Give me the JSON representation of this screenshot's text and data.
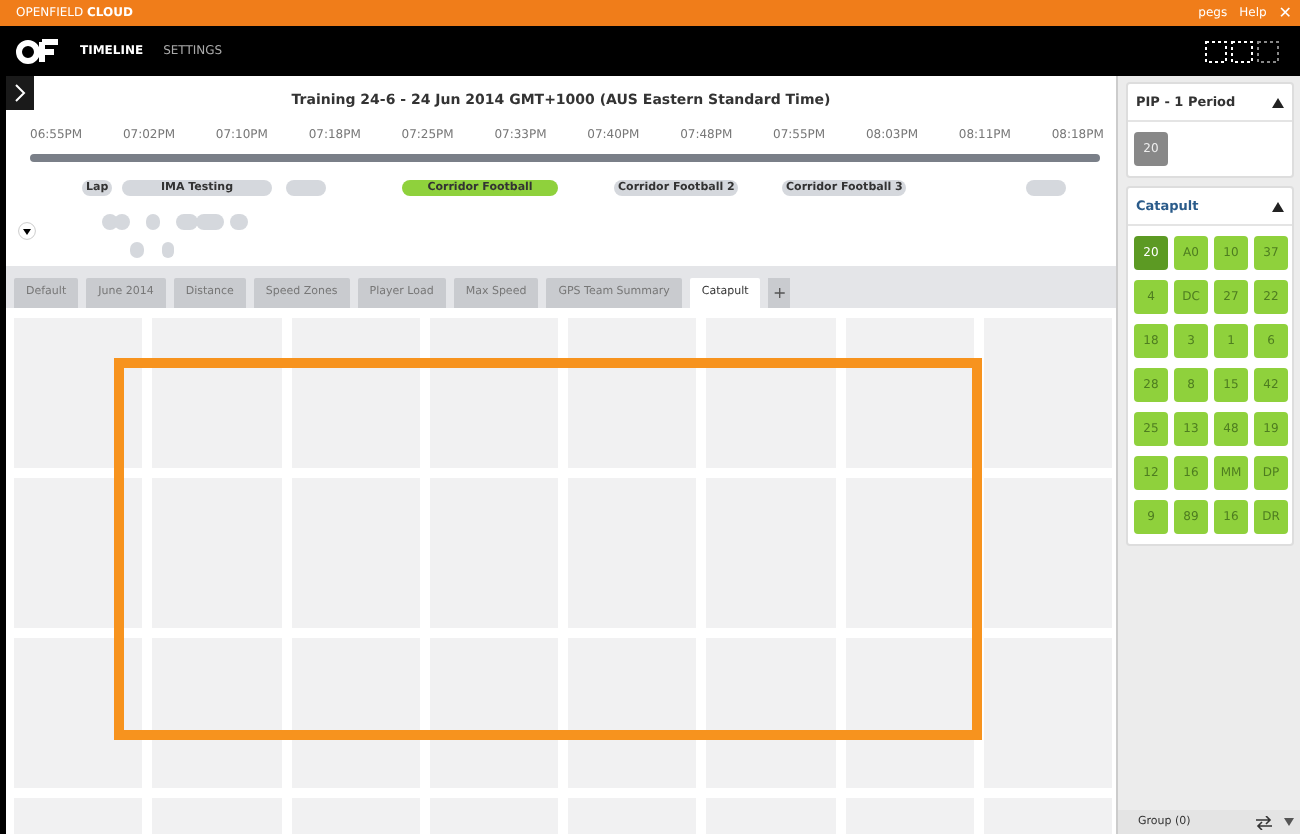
{
  "brand": {
    "light": "OPENFIELD",
    "bold": "CLOUD"
  },
  "user_links": [
    "pegs",
    "Help"
  ],
  "close_glyph": "✕",
  "nav": [
    {
      "label": "TIMELINE",
      "selected": true
    },
    {
      "label": "SETTINGS",
      "selected": false
    }
  ],
  "timeline": {
    "title": "Training 24-6 - 24 Jun 2014 GMT+1000 (AUS Eastern Standard Time)",
    "ticks": [
      "06:55PM",
      "07:02PM",
      "07:10PM",
      "07:18PM",
      "07:25PM",
      "07:33PM",
      "07:40PM",
      "07:48PM",
      "07:55PM",
      "08:03PM",
      "08:11PM",
      "08:18PM"
    ],
    "events": [
      {
        "label": "Lap",
        "selected": false
      },
      {
        "label": "IMA Testing",
        "selected": false
      },
      {
        "label": "Corridor Football",
        "selected": true
      },
      {
        "label": "Corridor Football 2",
        "selected": false
      },
      {
        "label": "Corridor Football 3",
        "selected": false
      }
    ]
  },
  "tabs": [
    {
      "label": "Default",
      "selected": false
    },
    {
      "label": "June 2014",
      "selected": false
    },
    {
      "label": "Distance",
      "selected": false
    },
    {
      "label": "Speed Zones",
      "selected": false
    },
    {
      "label": "Player Load",
      "selected": false
    },
    {
      "label": "Max Speed",
      "selected": false
    },
    {
      "label": "GPS Team Summary",
      "selected": false
    },
    {
      "label": "Catapult",
      "selected": true
    }
  ],
  "add_tab": "+",
  "panels": [
    {
      "title": "PIP - 1 Period",
      "kind": "grey",
      "tiles": [
        {
          "label": "20",
          "selected": false
        }
      ]
    },
    {
      "title": "Catapult",
      "kind": "green",
      "tiles": [
        {
          "label": "20",
          "selected": true
        },
        {
          "label": "A0",
          "selected": false
        },
        {
          "label": "10",
          "selected": false
        },
        {
          "label": "37",
          "selected": false
        },
        {
          "label": "4",
          "selected": false
        },
        {
          "label": "DC",
          "selected": false
        },
        {
          "label": "27",
          "selected": false
        },
        {
          "label": "22",
          "selected": false
        },
        {
          "label": "18",
          "selected": false
        },
        {
          "label": "3",
          "selected": false
        },
        {
          "label": "1",
          "selected": false
        },
        {
          "label": "6",
          "selected": false
        },
        {
          "label": "28",
          "selected": false
        },
        {
          "label": "8",
          "selected": false
        },
        {
          "label": "15",
          "selected": false
        },
        {
          "label": "42",
          "selected": false
        },
        {
          "label": "25",
          "selected": false
        },
        {
          "label": "13",
          "selected": false
        },
        {
          "label": "48",
          "selected": false
        },
        {
          "label": "19",
          "selected": false
        },
        {
          "label": "12",
          "selected": false
        },
        {
          "label": "16",
          "selected": false
        },
        {
          "label": "MM",
          "selected": false
        },
        {
          "label": "DP",
          "selected": false
        },
        {
          "label": "9",
          "selected": false
        },
        {
          "label": "89",
          "selected": false
        },
        {
          "label": "16",
          "selected": false
        },
        {
          "label": "DR",
          "selected": false
        }
      ]
    }
  ],
  "group_label": "Group (0)"
}
